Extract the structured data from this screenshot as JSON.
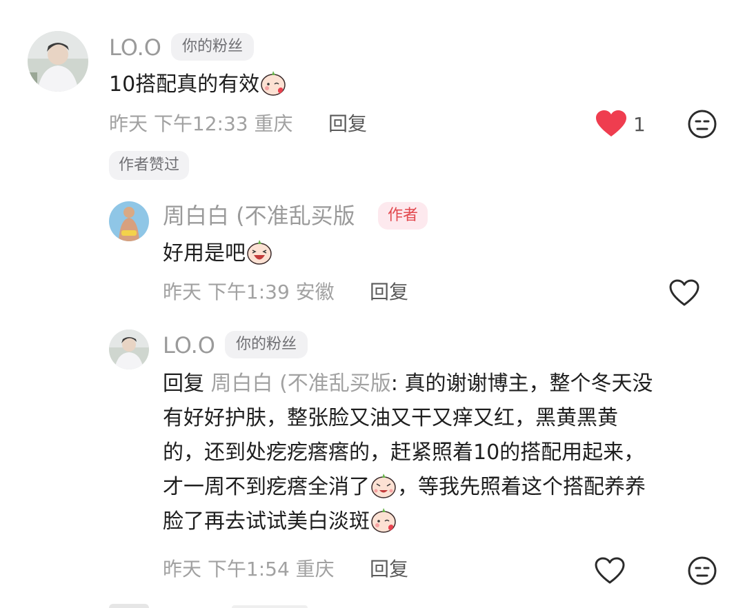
{
  "comments": [
    {
      "user": "LO.O",
      "badge": "你的粉丝",
      "text": "10搭配真的有效",
      "emoji": "blush-peach-emoji",
      "meta": "昨天 下午12:33 重庆",
      "reply_label": "回复",
      "like_count": "1",
      "liked": true,
      "author_liked_label": "作者赞过"
    },
    {
      "user": "周白白 (不准乱买版",
      "badge": "作者",
      "text": "好用是吧",
      "emoji": "laughing-peach-emoji",
      "meta": "昨天 下午1:39 安徽",
      "reply_label": "回复",
      "liked": false
    },
    {
      "user": "LO.O",
      "badge": "你的粉丝",
      "reply_prefix": "回复",
      "reply_to": "周白白 (不准乱买版",
      "lines": [
        ": 真的谢谢博主，整个冬天没",
        "有好好护肤，整张脸又油又干又痒又红，黑黄黑黄",
        "的，还到处疙疙瘩瘩的，赶紧照着10的搭配用起来，",
        "才一周不到疙瘩全消了",
        "，等我先照着这个搭配养养",
        "脸了再去试试美白淡斑"
      ],
      "meta": "昨天 下午1:54 重庆",
      "reply_label": "回复",
      "liked": false
    }
  ],
  "icons": {
    "heart_filled_color": "#ef3d4f",
    "heart_outline_color": "#2b2b2b",
    "dislike": "meh-face-icon"
  }
}
